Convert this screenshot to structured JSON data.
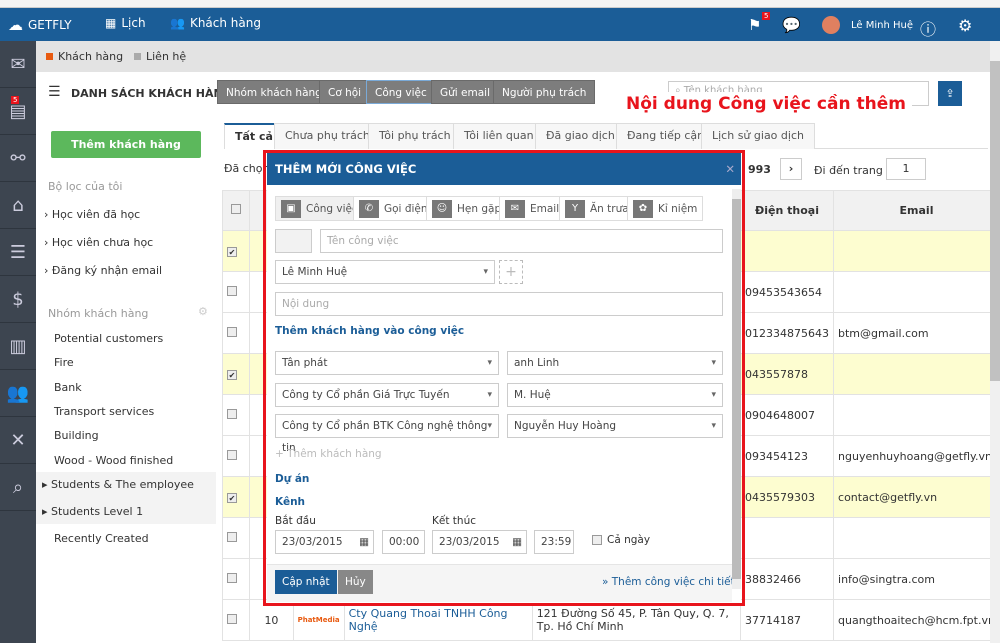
{
  "topbar": {
    "brand": "GETFLY",
    "nav": [
      "Lịch",
      "Khách hàng"
    ],
    "flag_badge": "5",
    "user": "Lê Minh Huệ",
    "colors": {
      "primary": "#1b5d97",
      "accent": "#e8141c",
      "green": "#5cb85c"
    }
  },
  "rail": {
    "badge": "5",
    "icons": [
      "mail-icon",
      "tasks-icon",
      "network-icon",
      "presentation-icon",
      "news-icon",
      "bag-money-icon",
      "books-icon",
      "users-icon",
      "graph-icon",
      "search-icon"
    ]
  },
  "subtabs": [
    "Khách hàng",
    "Liên hệ"
  ],
  "header": {
    "title": "DANH SÁCH KHÁCH HÀNG",
    "buttons": [
      "Nhóm khách hàng",
      "Cơ hội",
      "Công việc",
      "Gửi email",
      "Người phụ trách"
    ],
    "active_button": "Công việc",
    "search_placeholder": "Tên khách hàng"
  },
  "annotation": "Nội dung Công việc cần thêm",
  "left": {
    "add_button": "Thêm khách hàng",
    "filters_title": "Bộ lọc của tôi",
    "filters": [
      "Học viên đã học",
      "Học viên chưa học",
      "Đăng ký nhận email"
    ],
    "groups_title": "Nhóm khách hàng",
    "groups": [
      "Potential customers",
      "Fire",
      "Bank",
      "Transport services",
      "Building",
      "Wood - Wood finished",
      "Students & The employee",
      "Students Level 1",
      "Recently Created"
    ]
  },
  "tabs": [
    "Tất cả",
    "Chưa phụ trách",
    "Tôi phụ trách",
    "Tôi liên quan",
    "Đã giao dịch",
    "Đang tiếp cận",
    "Lịch sử giao dịch"
  ],
  "pager": {
    "selected_prefix": "Đã chọn",
    "total_suffix": "993",
    "goto_label": "Đi đến trang",
    "page": "1"
  },
  "table": {
    "headers": [
      "Điện thoại",
      "Email"
    ],
    "rows": [
      {
        "checked": true,
        "phone": "",
        "email": ""
      },
      {
        "checked": false,
        "phone": "09453543654",
        "email": ""
      },
      {
        "checked": false,
        "phone": "012334875643",
        "email": "btm@gmail.com"
      },
      {
        "checked": true,
        "phone": "043557878",
        "email": ""
      },
      {
        "checked": false,
        "phone": "0904648007",
        "email": ""
      },
      {
        "checked": false,
        "phone": "093454123",
        "email": "nguyenhuyhoang@getfly.vn"
      },
      {
        "checked": true,
        "phone": "0435579303",
        "email": "contact@getfly.vn"
      },
      {
        "checked": false,
        "phone": "",
        "email": ""
      },
      {
        "checked": false,
        "phone": "38832466",
        "email": "info@singtra.com"
      }
    ],
    "last_row": {
      "num": "10",
      "logo": "PhatMedia",
      "name": "Cty Quang Thoai TNHH Công Nghệ",
      "address": "121 Đường Số 45, P. Tân Quy, Q. 7, Tp. Hồ Chí Minh",
      "phone": "37714187",
      "email": "quangthoaitech@hcm.fpt.vn"
    }
  },
  "modal": {
    "title": "THÊM MỚI CÔNG VIỆC",
    "types": [
      "Công việc",
      "Gọi điện",
      "Hẹn gặp",
      "Email",
      "Ăn trưa",
      "Kỉ niệm"
    ],
    "name_placeholder": "Tên công việc",
    "assignee": "Lê Minh Huệ",
    "content_placeholder": "Nội dung",
    "add_customers_title": "Thêm khách hàng vào công việc",
    "customers": [
      [
        "Tân phát",
        "anh Linh"
      ],
      [
        "Công ty Cổ phần Giá Trực Tuyến",
        "M. Huệ"
      ],
      [
        "Công ty Cổ phần BTK Công nghệ thông tin",
        "Nguyễn Huy Hoàng"
      ]
    ],
    "add_customer": "Thêm khách hàng",
    "project": "Dự án",
    "channel": "Kênh",
    "start_label": "Bắt đầu",
    "end_label": "Kết thúc",
    "start_date": "23/03/2015",
    "start_time": "00:00",
    "end_date": "23/03/2015",
    "end_time": "23:59",
    "all_day": "Cả ngày",
    "save": "Cập nhật",
    "cancel": "Hủy",
    "detail_link": "» Thêm công việc chi tiết"
  }
}
